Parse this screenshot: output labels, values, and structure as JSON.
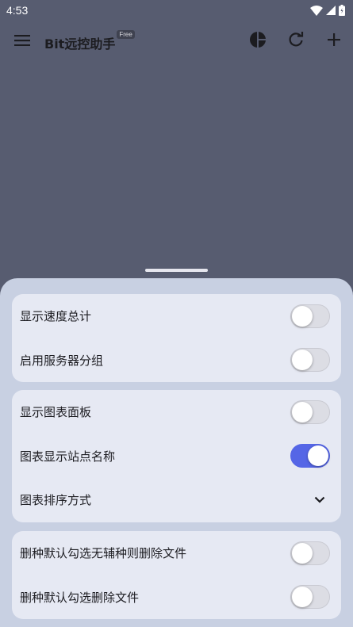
{
  "status_bar": {
    "time": "4:53",
    "icons": [
      "wifi-icon",
      "signal-icon",
      "battery-icon"
    ]
  },
  "app_bar": {
    "title": "Bit远控助手",
    "badge": "Free",
    "actions": [
      "pie-chart-icon",
      "refresh-icon",
      "add-icon"
    ]
  },
  "settings": {
    "groups": [
      {
        "items": [
          {
            "label": "显示速度总计",
            "type": "switch",
            "on": false
          },
          {
            "label": "启用服务器分组",
            "type": "switch",
            "on": false
          }
        ]
      },
      {
        "items": [
          {
            "label": "显示图表面板",
            "type": "switch",
            "on": false
          },
          {
            "label": "图表显示站点名称",
            "type": "switch",
            "on": true
          },
          {
            "label": "图表排序方式",
            "type": "dropdown"
          }
        ]
      },
      {
        "items": [
          {
            "label": "删种默认勾选无辅种则删除文件",
            "type": "switch",
            "on": false
          },
          {
            "label": "删种默认勾选删除文件",
            "type": "switch",
            "on": false
          }
        ]
      }
    ]
  },
  "colors": {
    "scrim": "#575c70",
    "sheet": "#c8d0e2",
    "card": "#e6e9f3",
    "switch_on": "#5566e6"
  }
}
